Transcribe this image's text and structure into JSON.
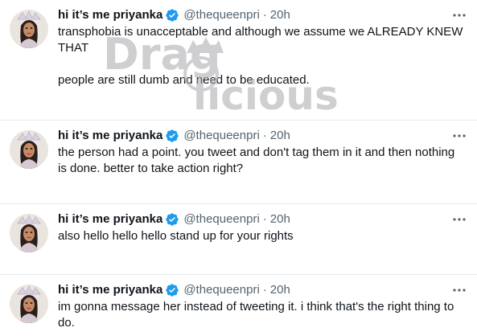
{
  "colors": {
    "verified": "#1d9bf0",
    "text": "#0f1419",
    "secondary": "#536471",
    "divider": "#e6ecf0"
  },
  "watermark": {
    "text": "Dragalicious"
  },
  "tweets": [
    {
      "name": "hi it’s me priyanka",
      "handle": "@thequeenpri",
      "separator": "·",
      "time": "20h",
      "lines": [
        "transphobia is unacceptable and although we assume we ALREADY KNEW THAT",
        "people are still dumb and need to be educated."
      ]
    },
    {
      "name": "hi it’s me priyanka",
      "handle": "@thequeenpri",
      "separator": "·",
      "time": "20h",
      "lines": [
        "the person had a point. you tweet and don't tag them in it and then nothing is done. better to take action right?"
      ]
    },
    {
      "name": "hi it’s me priyanka",
      "handle": "@thequeenpri",
      "separator": "·",
      "time": "20h",
      "lines": [
        "also hello hello hello stand up for your rights"
      ]
    },
    {
      "name": "hi it’s me priyanka",
      "handle": "@thequeenpri",
      "separator": "·",
      "time": "20h",
      "lines": [
        "im gonna message her instead of tweeting it. i think that's the right thing to do."
      ]
    }
  ]
}
